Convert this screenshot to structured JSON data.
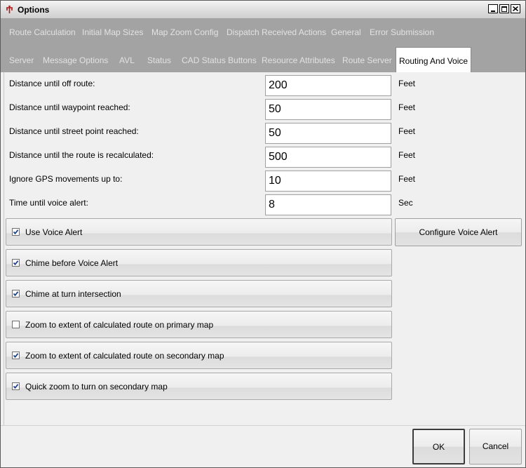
{
  "window": {
    "title": "Options"
  },
  "tabs": {
    "row1": [
      "Route Calculation",
      "Initial Map Sizes",
      "Map Zoom Config",
      "Dispatch Received Actions",
      "General",
      "Error Submission"
    ],
    "row2": [
      "Server",
      "Message Options",
      "AVL",
      "Status",
      "CAD Status Buttons",
      "Resource Attributes",
      "Route Server",
      "Routing And Voice"
    ],
    "active": "Routing And Voice"
  },
  "fields": [
    {
      "label": "Distance until off route:",
      "value": "200",
      "unit": "Feet"
    },
    {
      "label": "Distance until waypoint reached:",
      "value": "50",
      "unit": "Feet"
    },
    {
      "label": "Distance until street point reached:",
      "value": "50",
      "unit": "Feet"
    },
    {
      "label": "Distance until the route is recalculated:",
      "value": "500",
      "unit": "Feet"
    },
    {
      "label": "Ignore GPS movements up to:",
      "value": "10",
      "unit": "Feet"
    },
    {
      "label": "Time until voice alert:",
      "value": "8",
      "unit": "Sec"
    }
  ],
  "options": [
    {
      "label": "Use Voice Alert",
      "checked": true
    },
    {
      "label": "Chime before Voice Alert",
      "checked": true
    },
    {
      "label": "Chime at turn intersection",
      "checked": true
    },
    {
      "label": "Zoom to extent of calculated route on primary map",
      "checked": false
    },
    {
      "label": "Zoom to extent of calculated route on secondary map",
      "checked": true
    },
    {
      "label": "Quick zoom to turn on secondary map",
      "checked": true
    }
  ],
  "buttons": {
    "configure": "Configure Voice Alert",
    "ok": "OK",
    "cancel": "Cancel"
  },
  "icons": {
    "app": "app-icon",
    "minimize": "minimize-icon",
    "maximize": "maximize-icon",
    "close": "close-icon",
    "check": "checkmark-icon"
  },
  "colors": {
    "tab_strip": "#a3a3a3",
    "tab_text": "#e2e2e2",
    "panel": "#f0f0f0"
  }
}
